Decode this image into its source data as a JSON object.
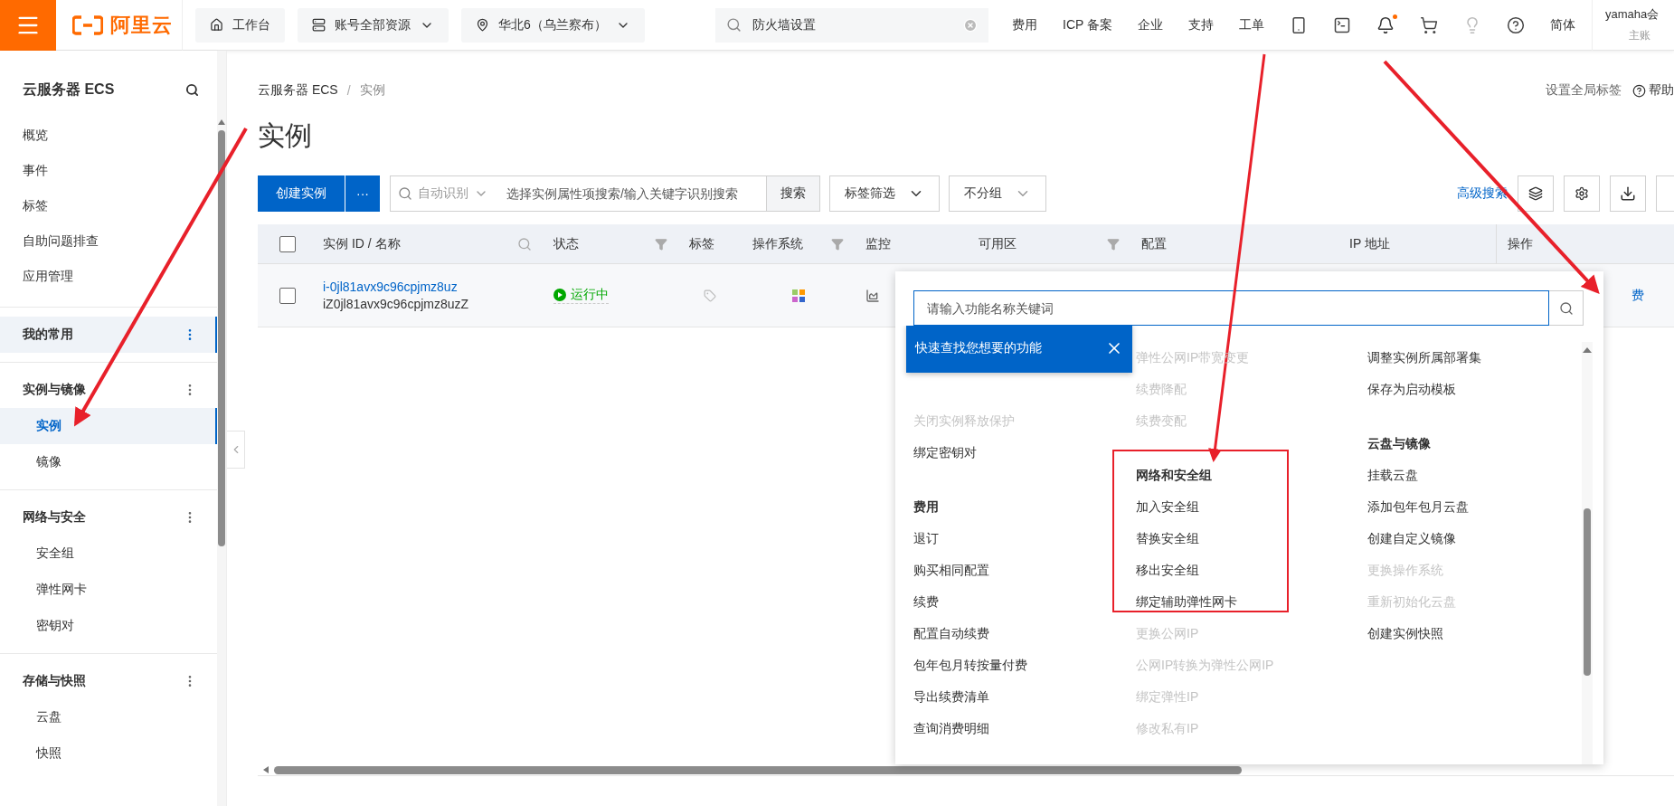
{
  "topbar": {
    "logo_text": "阿里云",
    "nav": [
      {
        "label": "工作台",
        "kind": "home"
      },
      {
        "label": "账号全部资源",
        "kind": "resources"
      },
      {
        "label": "华北6（乌兰察布）",
        "kind": "region"
      }
    ],
    "search": {
      "value": "防火墙设置"
    },
    "links": [
      "费用",
      "ICP 备案",
      "企业",
      "支持",
      "工单"
    ],
    "tools": [
      {
        "kind": "app",
        "badge": false
      },
      {
        "kind": "terminal",
        "badge": false
      },
      {
        "kind": "bell",
        "badge": true
      },
      {
        "kind": "cart",
        "badge": false
      },
      {
        "kind": "bulb",
        "badge": false
      },
      {
        "kind": "help",
        "badge": false
      }
    ],
    "language": "简体",
    "user": {
      "name": "yamaha会",
      "role": "主账"
    }
  },
  "sidebar": {
    "title": "云服务器 ECS",
    "items": [
      {
        "label": "概览",
        "selected": false
      },
      {
        "label": "事件",
        "selected": false
      },
      {
        "label": "标签",
        "selected": false
      },
      {
        "label": "自助问题排查",
        "selected": false
      },
      {
        "label": "应用管理",
        "selected": false
      }
    ],
    "sections": [
      {
        "title": "我的常用",
        "selected": true
      },
      {
        "title": "实例与镜像",
        "selected": false,
        "items": [
          {
            "label": "实例",
            "selected": true
          },
          {
            "label": "镜像",
            "selected": false
          }
        ]
      },
      {
        "title": "网络与安全",
        "selected": false,
        "items": [
          {
            "label": "安全组",
            "selected": false
          },
          {
            "label": "弹性网卡",
            "selected": false
          },
          {
            "label": "密钥对",
            "selected": false
          }
        ]
      },
      {
        "title": "存储与快照",
        "selected": false,
        "items": [
          {
            "label": "云盘",
            "selected": false
          },
          {
            "label": "快照",
            "selected": false
          }
        ]
      }
    ]
  },
  "page": {
    "breadcrumb": [
      "云服务器 ECS",
      "实例"
    ],
    "breadcrumb_separator": "/",
    "global_tags": "设置全局标签",
    "help": "帮助",
    "title": "实例"
  },
  "toolbar": {
    "create": "创建实例",
    "more": "···",
    "search": {
      "scope": "自动识别",
      "placeholder": "选择实例属性项搜索/输入关键字识别搜索",
      "button": "搜索"
    },
    "tag_filter": "标签筛选",
    "grouping": "不分组",
    "advanced": "高级搜索",
    "icon_buttons": [
      {
        "kind": "layers"
      },
      {
        "kind": "settings"
      },
      {
        "kind": "download"
      }
    ]
  },
  "table": {
    "select_all_checked": false,
    "columns": [
      {
        "label": "实例 ID / 名称",
        "searchable": true,
        "filterable": false
      },
      {
        "label": "状态",
        "searchable": false,
        "filterable": true
      },
      {
        "label": "标签",
        "searchable": false,
        "filterable": false
      },
      {
        "label": "操作系统",
        "searchable": false,
        "filterable": true
      },
      {
        "label": "监控",
        "searchable": false,
        "filterable": false
      },
      {
        "label": "可用区",
        "searchable": false,
        "filterable": true
      },
      {
        "label": "配置",
        "searchable": false,
        "filterable": false
      },
      {
        "label": "IP 地址",
        "searchable": false,
        "filterable": false
      },
      {
        "label": "操作",
        "searchable": false,
        "filterable": false
      }
    ],
    "rows": [
      {
        "checked": false,
        "id": "i-0jl81avx9c96cpjmz8uz",
        "name": "iZ0jl81avx9c96cpjmz8uzZ",
        "status": "运行中",
        "operation": "费"
      }
    ]
  },
  "popup": {
    "placeholder": "请输入功能名称关键词",
    "tooltip": "快速查找您想要的功能",
    "columns": [
      {
        "groups": [
          {
            "items": [
              {
                "label": "关闭实例释放保护",
                "disabled": true
              },
              {
                "label": "绑定密钥对",
                "disabled": false
              }
            ]
          },
          {
            "heading": "费用",
            "items": [
              {
                "label": "退订",
                "disabled": false
              },
              {
                "label": "购买相同配置",
                "disabled": false
              },
              {
                "label": "续费",
                "disabled": false
              },
              {
                "label": "配置自动续费",
                "disabled": false
              },
              {
                "label": "包年包月转按量付费",
                "disabled": false
              },
              {
                "label": "导出续费清单",
                "disabled": false
              },
              {
                "label": "查询消费明细",
                "disabled": false
              }
            ]
          }
        ]
      },
      {
        "groups": [
          {
            "items": [
              {
                "label": "弹性公网IP带宽变更",
                "disabled": true
              },
              {
                "label": "续费降配",
                "disabled": true
              },
              {
                "label": "续费变配",
                "disabled": true
              }
            ]
          },
          {
            "heading": "网络和安全组",
            "items": [
              {
                "label": "加入安全组",
                "disabled": false
              },
              {
                "label": "替换安全组",
                "disabled": false
              },
              {
                "label": "移出安全组",
                "disabled": false
              },
              {
                "label": "绑定辅助弹性网卡",
                "disabled": false
              },
              {
                "label": "更换公网IP",
                "disabled": true
              },
              {
                "label": "公网IP转换为弹性公网IP",
                "disabled": true
              },
              {
                "label": "绑定弹性IP",
                "disabled": true
              },
              {
                "label": "修改私有IP",
                "disabled": true
              }
            ]
          }
        ]
      },
      {
        "groups": [
          {
            "items": [
              {
                "label": "调整实例所属部署集",
                "disabled": false
              },
              {
                "label": "保存为启动模板",
                "disabled": false
              }
            ]
          },
          {
            "heading": "云盘与镜像",
            "items": [
              {
                "label": "挂载云盘",
                "disabled": false
              },
              {
                "label": "添加包年包月云盘",
                "disabled": false
              },
              {
                "label": "创建自定义镜像",
                "disabled": false
              },
              {
                "label": "更换操作系统",
                "disabled": true
              },
              {
                "label": "重新初始化云盘",
                "disabled": true
              },
              {
                "label": "创建实例快照",
                "disabled": false
              }
            ]
          }
        ]
      }
    ]
  }
}
